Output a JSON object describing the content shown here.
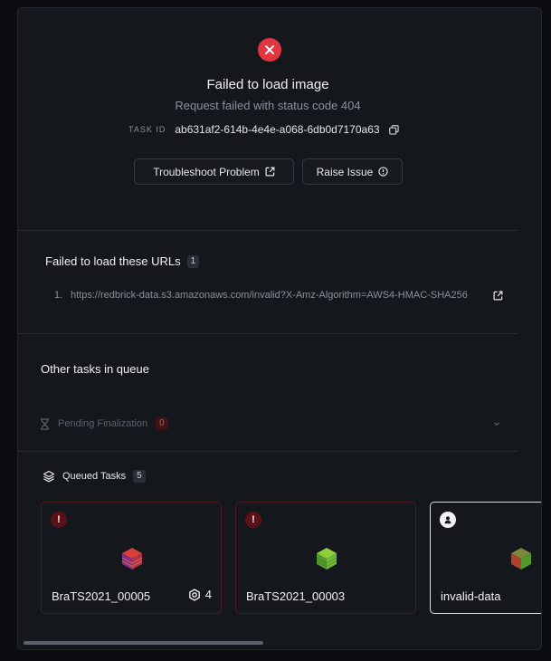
{
  "error": {
    "icon": "close-icon",
    "color": "#e5343d",
    "title": "Failed to load image",
    "subtitle": "Request failed with status code 404",
    "task_id_label": "TASK ID",
    "task_id": "ab631af2-614b-4e4e-a068-6db0d7170a63"
  },
  "actions": {
    "troubleshoot_label": "Troubleshoot Problem",
    "raise_issue_label": "Raise Issue"
  },
  "failed_urls": {
    "title": "Failed to load these URLs",
    "count": "1",
    "items": [
      {
        "index": "1.",
        "url": "https://redbrick-data.s3.amazonaws.com/invalid?X-Amz-Algorithm=AWS4-HMAC-SHA256"
      }
    ]
  },
  "queue": {
    "title": "Other tasks in queue",
    "pending": {
      "label": "Pending Finalization",
      "count": "0"
    },
    "queued": {
      "label": "Queued Tasks",
      "count": "5"
    },
    "cards": [
      {
        "name": "BraTS2021_00005",
        "count": "4",
        "status_icon": "warning-icon"
      },
      {
        "name": "BraTS2021_00003",
        "count": "",
        "status_icon": "warning-icon"
      },
      {
        "name": "invalid-data",
        "count": "",
        "status_icon": "user-icon"
      }
    ]
  }
}
